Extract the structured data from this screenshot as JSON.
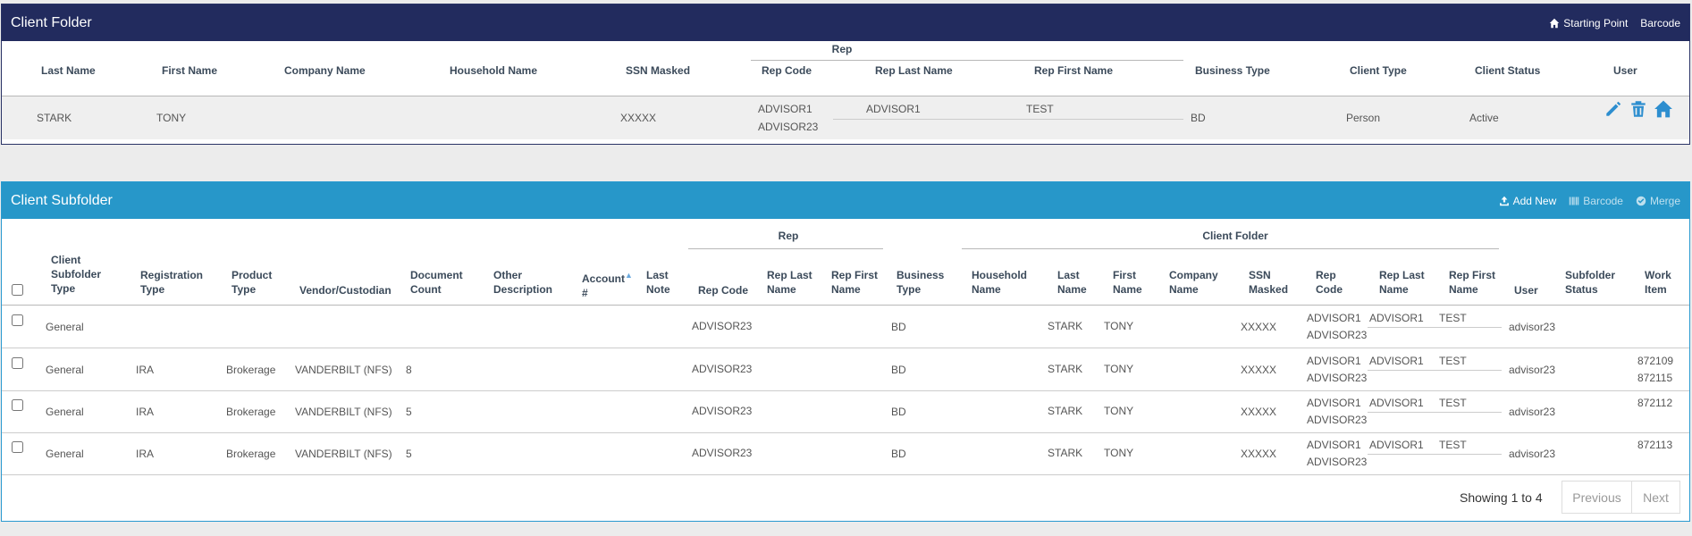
{
  "client_folder": {
    "title": "Client Folder",
    "links": {
      "starting_point": "Starting Point",
      "barcode": "Barcode"
    },
    "group_header": "Rep",
    "columns": {
      "last_name": "Last Name",
      "first_name": "First Name",
      "company_name": "Company Name",
      "household_name": "Household Name",
      "ssn_masked": "SSN Masked",
      "rep_code": "Rep Code",
      "rep_last_name": "Rep Last Name",
      "rep_first_name": "Rep First Name",
      "business_type": "Business Type",
      "client_type": "Client Type",
      "client_status": "Client Status",
      "user": "User"
    },
    "row": {
      "last_name": "STARK",
      "first_name": "TONY",
      "ssn": "XXXXX",
      "rep_code_1": "ADVISOR1",
      "rep_code_2": "ADVISOR23",
      "rep_last_name": "ADVISOR1",
      "rep_first_name": "TEST",
      "business_type": "BD",
      "client_type": "Person",
      "client_status": "Active"
    },
    "icons": [
      "pencil-icon",
      "trash-icon",
      "home-icon"
    ]
  },
  "client_subfolder": {
    "title": "Client Subfolder",
    "links": {
      "add_new": "Add New",
      "barcode": "Barcode",
      "merge": "Merge"
    },
    "group_headers": {
      "rep": "Rep",
      "client_folder": "Client Folder"
    },
    "columns": {
      "subfolder_type": [
        "Client",
        "Subfolder",
        "Type"
      ],
      "registration_type": [
        "Registration",
        "Type"
      ],
      "product_type": [
        "Product",
        "Type"
      ],
      "vendor": "Vendor/Custodian",
      "document_count": [
        "Document",
        "Count"
      ],
      "other_description": [
        "Other",
        "Description"
      ],
      "account": [
        "Account",
        "#"
      ],
      "last_note": [
        "Last",
        "Note"
      ],
      "rep_code": "Rep Code",
      "rep_last_name": [
        "Rep Last",
        "Name"
      ],
      "rep_first_name": [
        "Rep First",
        "Name"
      ],
      "business_type": [
        "Business",
        "Type"
      ],
      "household_name": [
        "Household",
        "Name"
      ],
      "last_name": [
        "Last",
        "Name"
      ],
      "first_name": [
        "First",
        "Name"
      ],
      "company_name": [
        "Company",
        "Name"
      ],
      "ssn_masked": [
        "SSN",
        "Masked"
      ],
      "cf_rep_code": [
        "Rep",
        "Code"
      ],
      "cf_rep_last_name": [
        "Rep Last",
        "Name"
      ],
      "cf_rep_first_name": [
        "Rep First",
        "Name"
      ],
      "user": "User",
      "subfolder_status": [
        "Subfolder",
        "Status"
      ],
      "work_item": [
        "Work",
        "Item"
      ]
    },
    "rows": [
      {
        "type": "General",
        "reg": "",
        "product": "",
        "vendor": "",
        "doc_count": "",
        "rep_code": "ADVISOR23",
        "business": "BD",
        "last": "STARK",
        "first": "TONY",
        "ssn": "XXXXX",
        "cf_rep_code_1": "ADVISOR1",
        "cf_rep_code_2": "ADVISOR23",
        "cf_rep_last": "ADVISOR1",
        "cf_rep_first": "TEST",
        "user": "advisor23",
        "work_1": "",
        "work_2": ""
      },
      {
        "type": "General",
        "reg": "IRA",
        "product": "Brokerage",
        "vendor": "VANDERBILT (NFS)",
        "doc_count": "8",
        "rep_code": "ADVISOR23",
        "business": "BD",
        "last": "STARK",
        "first": "TONY",
        "ssn": "XXXXX",
        "cf_rep_code_1": "ADVISOR1",
        "cf_rep_code_2": "ADVISOR23",
        "cf_rep_last": "ADVISOR1",
        "cf_rep_first": "TEST",
        "user": "advisor23",
        "work_1": "872109",
        "work_2": "872115"
      },
      {
        "type": "General",
        "reg": "IRA",
        "product": "Brokerage",
        "vendor": "VANDERBILT (NFS)",
        "doc_count": "5",
        "rep_code": "ADVISOR23",
        "business": "BD",
        "last": "STARK",
        "first": "TONY",
        "ssn": "XXXXX",
        "cf_rep_code_1": "ADVISOR1",
        "cf_rep_code_2": "ADVISOR23",
        "cf_rep_last": "ADVISOR1",
        "cf_rep_first": "TEST",
        "user": "advisor23",
        "work_1": "872112",
        "work_2": ""
      },
      {
        "type": "General",
        "reg": "IRA",
        "product": "Brokerage",
        "vendor": "VANDERBILT (NFS)",
        "doc_count": "5",
        "rep_code": "ADVISOR23",
        "business": "BD",
        "last": "STARK",
        "first": "TONY",
        "ssn": "XXXXX",
        "cf_rep_code_1": "ADVISOR1",
        "cf_rep_code_2": "ADVISOR23",
        "cf_rep_last": "ADVISOR1",
        "cf_rep_first": "TEST",
        "user": "advisor23",
        "work_1": "872113",
        "work_2": ""
      }
    ],
    "pagination": {
      "info": "Showing 1 to 4",
      "previous": "Previous",
      "next": "Next"
    }
  },
  "colors": {
    "folder_header": "#222b5e",
    "subfolder_header": "#2797c9",
    "icon": "#2d8ecf"
  }
}
